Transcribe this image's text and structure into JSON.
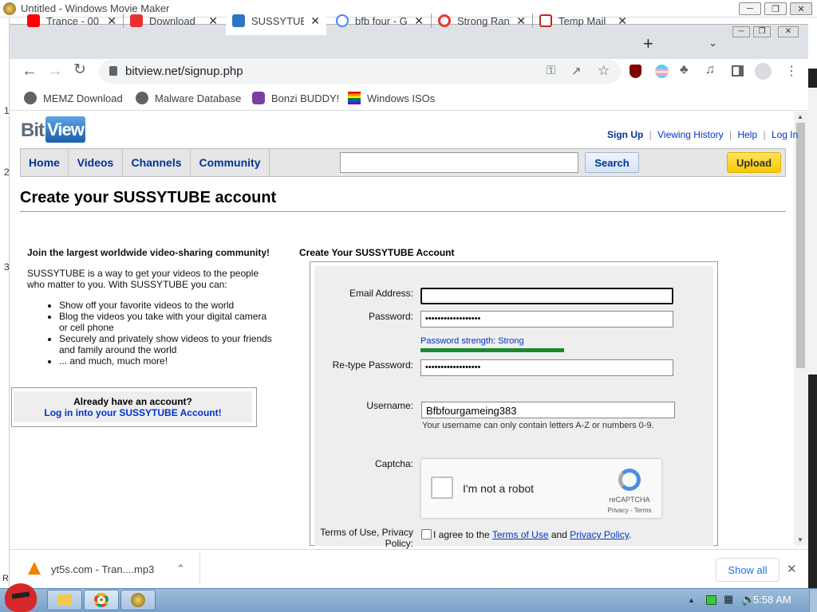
{
  "window": {
    "title": "Untitled - Windows Movie Maker",
    "side_numbers": [
      "1",
      "2",
      "3"
    ],
    "r_label": "R"
  },
  "tabs": [
    {
      "label": "Trance - 00",
      "icon": "youtube-icon",
      "color": "#ff0000"
    },
    {
      "label": "Download",
      "icon": "yt5s-icon",
      "color": "#e8312f"
    },
    {
      "label": "SUSSYTUBE",
      "icon": "bitview-icon",
      "color": "#2e74c4"
    },
    {
      "label": "bfb four - G",
      "icon": "google-icon",
      "color": "#4285f4"
    },
    {
      "label": "Strong Ran",
      "icon": "pw-generator-icon",
      "color": "#e53935"
    },
    {
      "label": "Temp Mail",
      "icon": "gmail-icon",
      "color": "#c5221f"
    }
  ],
  "address": {
    "url": "bitview.net/signup.php"
  },
  "bookmarks": [
    {
      "label": "MEMZ Download",
      "icon": "globe-icon"
    },
    {
      "label": "Malware Database",
      "icon": "globe-icon"
    },
    {
      "label": "Bonzi BUDDY!",
      "icon": "bonzi-icon"
    },
    {
      "label": "Windows ISOs",
      "icon": "rainbow-flag-icon"
    }
  ],
  "site": {
    "logo_bit": "Bit",
    "logo_view": "View",
    "top_links": [
      "Sign Up",
      "Viewing History",
      "Help",
      "Log In"
    ],
    "nav": [
      "Home",
      "Videos",
      "Channels",
      "Community"
    ],
    "search_button": "Search",
    "upload_button": "Upload",
    "page_title": "Create your SUSSYTUBE account"
  },
  "left": {
    "heading": "Join the largest worldwide video-sharing community!",
    "intro": "SUSSYTUBE is a way to get your videos to the people who matter to you. With SUSSYTUBE you can:",
    "bullets": [
      "Show off your favorite videos to the world",
      "Blog the videos you take with your digital camera or cell phone",
      "Securely and privately show videos to your friends and family around the world",
      "... and much, much more!"
    ],
    "account_q": "Already have an account?",
    "account_link": "Log in into your SUSSYTUBE Account!"
  },
  "form": {
    "heading": "Create Your SUSSYTUBE Account",
    "email_label": "Email Address:",
    "email_value": "",
    "password_label": "Password:",
    "password_value": "••••••••••••••••••",
    "strength_text": "Password strength: Strong",
    "strength_color": "#1a8a2a",
    "retype_label": "Re-type Password:",
    "retype_value": "••••••••••••••••••",
    "username_label": "Username:",
    "username_value": "Bfbfourgameing383",
    "username_hint": "Your username can only contain letters A-Z or numbers 0-9.",
    "captcha_label": "Captcha:",
    "captcha_text": "I'm not a robot",
    "captcha_brand": "reCAPTCHA",
    "captcha_links": "Privacy - Terms",
    "terms_label": "Terms of Use, Privacy Policy:",
    "terms_prefix": "I agree to the",
    "terms_link": "Terms of Use",
    "terms_and": "and",
    "privacy_link": "Privacy Policy",
    "terms_end": "."
  },
  "downloads": {
    "file": "yt5s.com - Tran....mp3",
    "show_all": "Show all"
  },
  "taskbar": {
    "clock": "5:58 AM"
  }
}
